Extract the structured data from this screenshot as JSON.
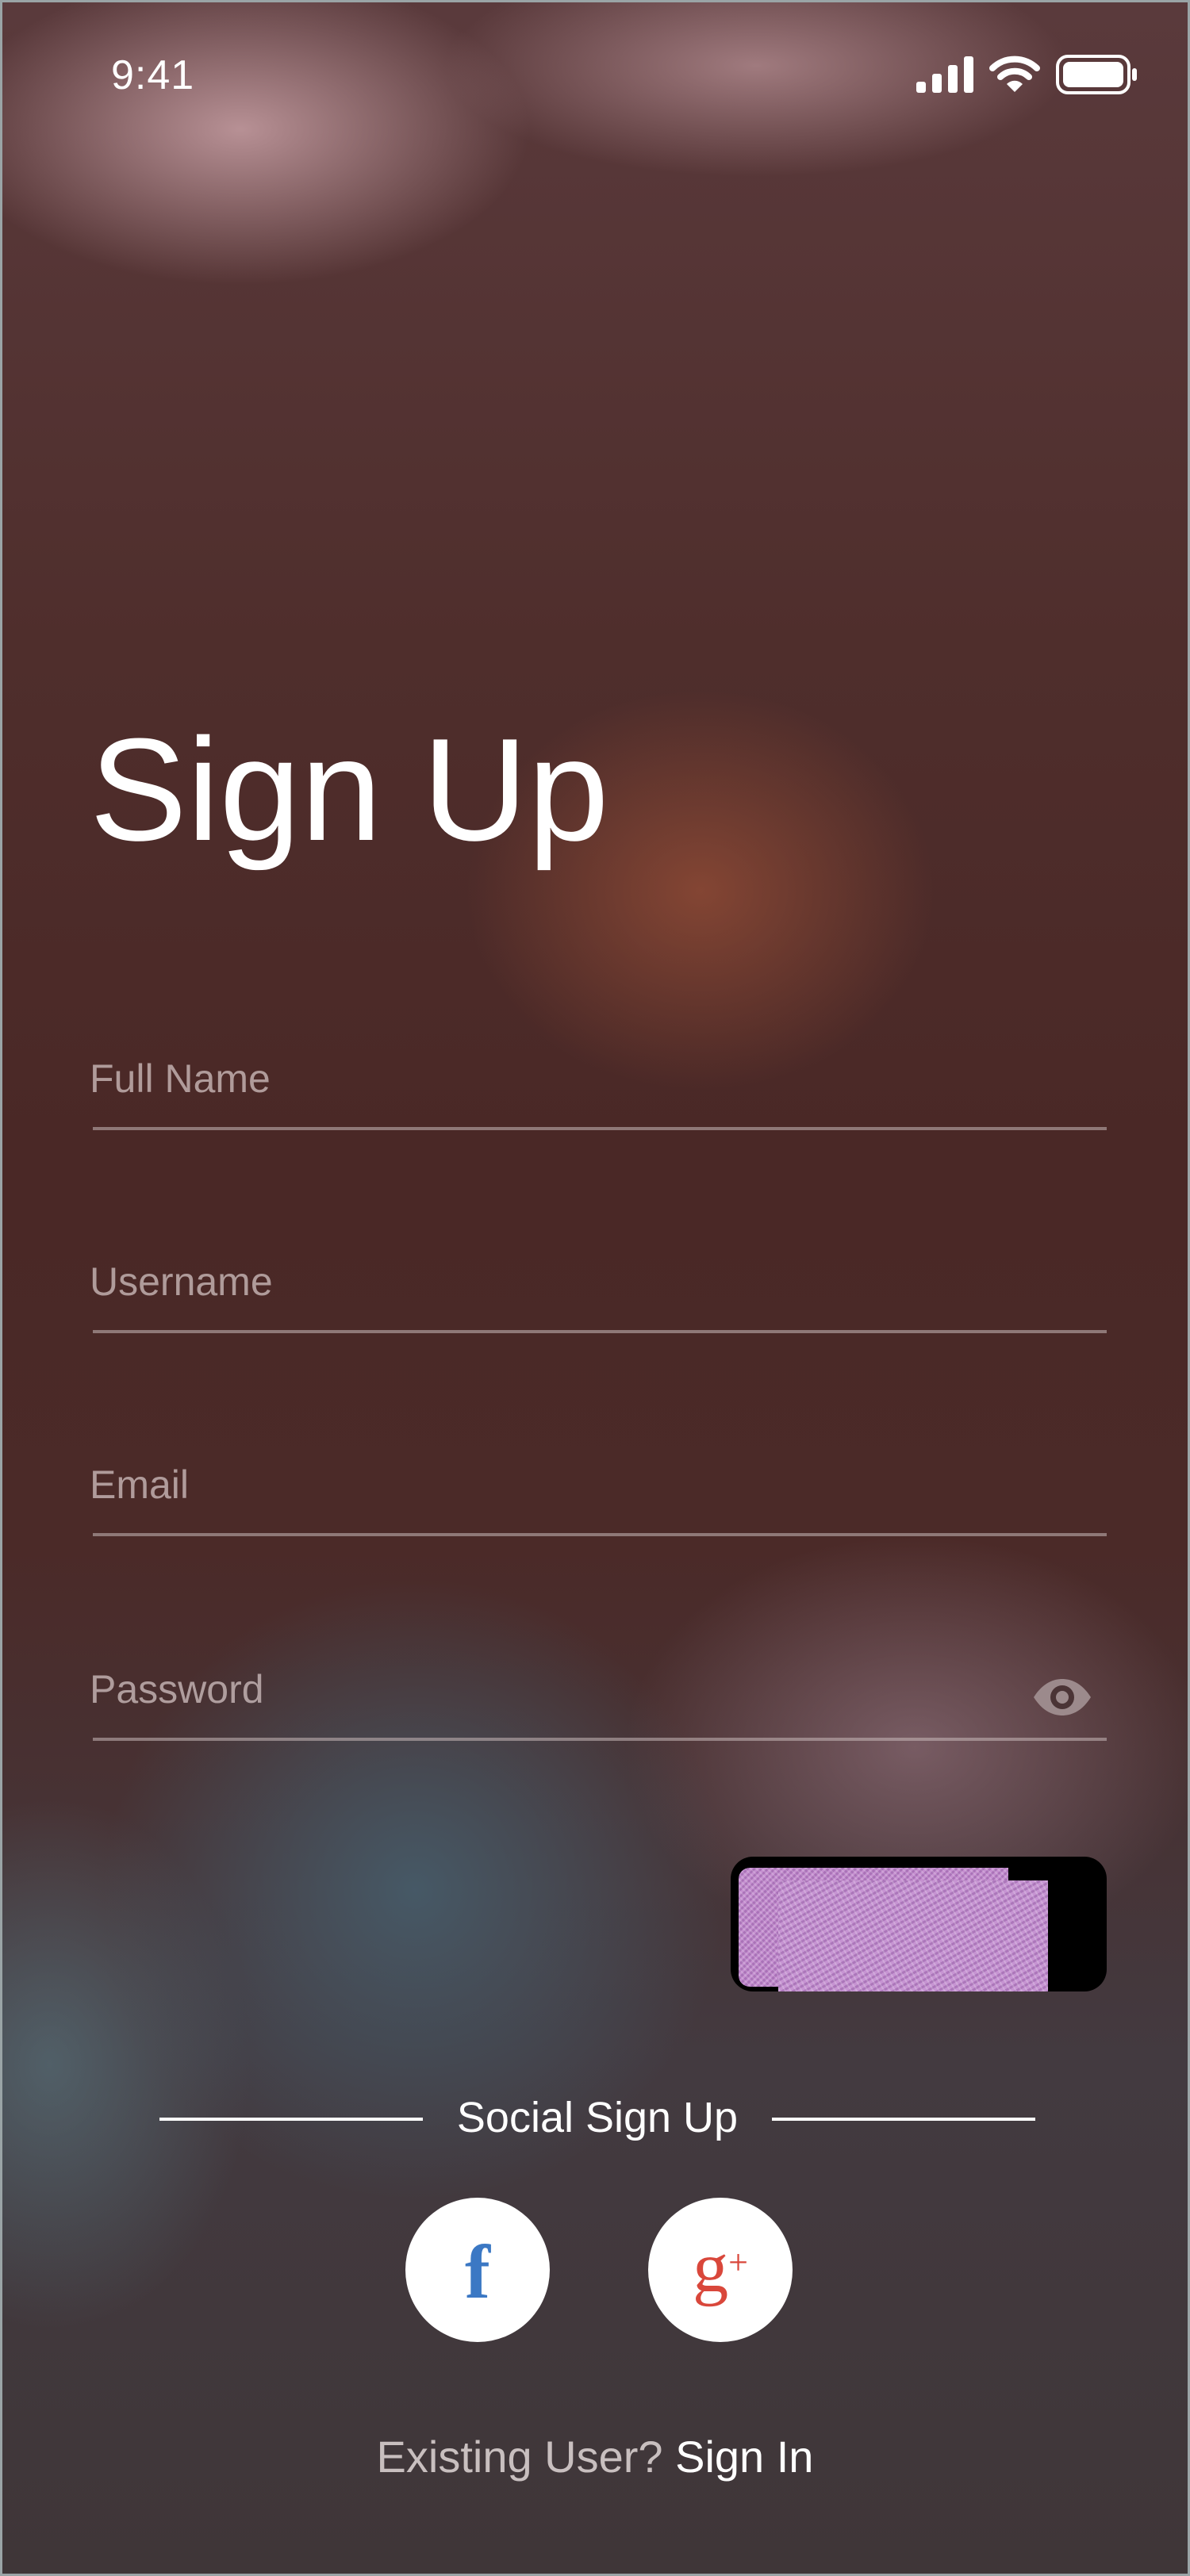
{
  "status_bar": {
    "time": "9:41",
    "icons": [
      "signal-icon",
      "wifi-icon",
      "battery-icon"
    ]
  },
  "page": {
    "title": "Sign Up"
  },
  "form": {
    "full_name": {
      "placeholder": "Full Name",
      "value": ""
    },
    "username": {
      "placeholder": "Username",
      "value": ""
    },
    "email": {
      "placeholder": "Email",
      "value": ""
    },
    "password": {
      "placeholder": "Password",
      "value": "",
      "toggle_icon": "eye-icon"
    }
  },
  "social": {
    "label": "Social Sign Up",
    "buttons": [
      {
        "name": "facebook",
        "glyph": "f",
        "icon": "facebook-icon",
        "color": "#3b78c4"
      },
      {
        "name": "google-plus",
        "glyph": "g",
        "glyph_sup": "+",
        "icon": "google-plus-icon",
        "color": "#d9473b"
      }
    ]
  },
  "footer": {
    "prompt": "Existing User?",
    "link": "Sign In"
  },
  "colors": {
    "text": "#ffffff",
    "placeholder": "#d7c8c8",
    "facebook": "#3b78c4",
    "google_plus": "#d9473b"
  }
}
